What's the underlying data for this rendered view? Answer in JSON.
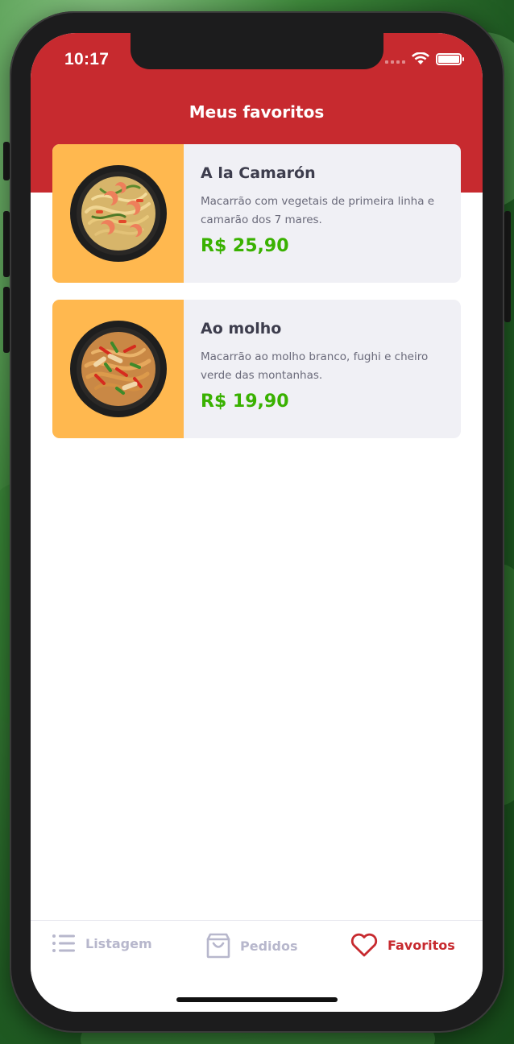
{
  "status_bar": {
    "time": "10:17"
  },
  "header": {
    "title": "Meus favoritos"
  },
  "favorites": [
    {
      "title": "A la Camarón",
      "description": "Macarrão com vegetais de primeira linha e camarão dos 7 mares.",
      "price": "R$ 25,90"
    },
    {
      "title": "Ao molho",
      "description": "Macarrão ao molho branco, fughi e cheiro verde das montanhas.",
      "price": "R$ 19,90"
    }
  ],
  "tabbar": {
    "items": [
      {
        "label": "Listagem",
        "icon": "list-icon",
        "active": false
      },
      {
        "label": "Pedidos",
        "icon": "shopping-bag-icon",
        "active": false
      },
      {
        "label": "Favoritos",
        "icon": "heart-icon",
        "active": true
      }
    ]
  },
  "colors": {
    "primary": "#C72A2F",
    "price": "#39B100",
    "card_image_bg": "#FFB84F",
    "card_bg": "#F0F0F5",
    "inactive_tab": "#B7B7CC"
  }
}
